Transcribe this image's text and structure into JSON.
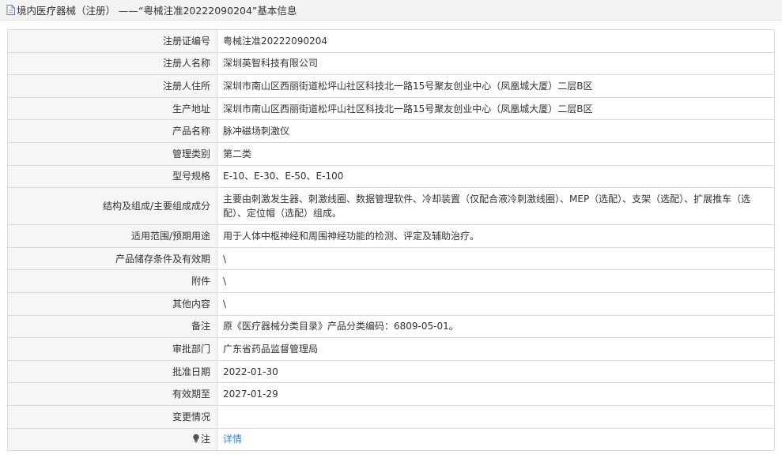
{
  "header": {
    "title": "境内医疗器械（注册）  ——“粤械注准20222090204”基本信息",
    "icon": "document-icon"
  },
  "rows": [
    {
      "key": "reg-number",
      "label": "注册证编号",
      "value": "粤械注准20222090204"
    },
    {
      "key": "registrant-name",
      "label": "注册人名称",
      "value": "深圳英智科技有限公司"
    },
    {
      "key": "registrant-address",
      "label": "注册人住所",
      "value": "深圳市南山区西丽街道松坪山社区科技北一路15号聚友创业中心（凤凰城大厦）二层B区"
    },
    {
      "key": "production-address",
      "label": "生产地址",
      "value": "深圳市南山区西丽街道松坪山社区科技北一路15号聚友创业中心（凤凰城大厦）二层B区"
    },
    {
      "key": "product-name",
      "label": "产品名称",
      "value": "脉冲磁场刺激仪"
    },
    {
      "key": "management-class",
      "label": "管理类别",
      "value": "第二类"
    },
    {
      "key": "model-spec",
      "label": "型号规格",
      "value": "E-10、E-30、E-50、E-100"
    },
    {
      "key": "structure",
      "label": "结构及组成/主要组成成分",
      "value": "主要由刺激发生器、刺激线圈、数据管理软件、冷却装置（仅配合液冷刺激线圈）、MEP（选配）、支架（选配）、扩展推车（选配）、定位帽（选配）组成。",
      "tall": true
    },
    {
      "key": "intended-use",
      "label": "适用范围/预期用途",
      "value": "用于人体中枢神经和周围神经功能的检测、评定及辅助治疗。"
    },
    {
      "key": "storage",
      "label": "产品储存条件及有效期",
      "value": "\\"
    },
    {
      "key": "attachments",
      "label": "附件",
      "value": "\\"
    },
    {
      "key": "other",
      "label": "其他内容",
      "value": "\\"
    },
    {
      "key": "remarks",
      "label": "备注",
      "value": "原《医疗器械分类目录》产品分类编码：6809-05-01。"
    },
    {
      "key": "approval-dept",
      "label": "审批部门",
      "value": "广东省药品监督管理局"
    },
    {
      "key": "approval-date",
      "label": "批准日期",
      "value": "2022-01-30"
    },
    {
      "key": "valid-until",
      "label": "有效期至",
      "value": "2027-01-29"
    },
    {
      "key": "changes",
      "label": "变更情况",
      "value": ""
    }
  ],
  "note_row": {
    "label": "注",
    "icon": "lightbulb-icon",
    "link_text": "详情"
  },
  "colors": {
    "label_bg": "#f6f6f6",
    "border": "#dcdcdc",
    "link": "#3b7fc4",
    "title_bg": "#f3f3f3"
  }
}
